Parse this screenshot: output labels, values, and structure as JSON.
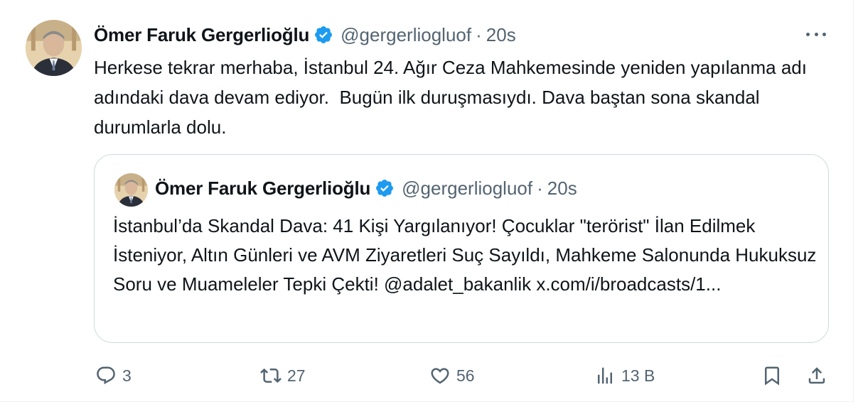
{
  "tweet": {
    "author_name": "Ömer Faruk Gergerlioğlu",
    "handle": "@gergerliogluof",
    "separator": "·",
    "time": "20s",
    "text": "Herkese tekrar merhaba, İstanbul 24. Ağır Ceza Mahkemesinde yeniden yapılanma adı adındaki dava devam ediyor.  Bugün ilk duruşmasıydı. Dava baştan sona skandal durumlarla dolu."
  },
  "quote": {
    "author_name": "Ömer Faruk Gergerlioğlu",
    "handle": "@gergerliogluof",
    "separator": "·",
    "time": "20s",
    "text": "İstanbul’da Skandal Dava: 41 Kişi Yargılanıyor! Çocuklar \"terörist\" İlan Edilmek İsteniyor, Altın Günleri ve AVM Ziyaretleri Suç Sayıldı, Mahkeme Salonunda Hukuksuz Soru ve Muameleler Tepki Çekti! @adalet_bakanlik x.com/i/broadcasts/1..."
  },
  "actions": {
    "replies": "3",
    "reposts": "27",
    "likes": "56",
    "views": "13 B"
  },
  "icons": {
    "verified": "verified-badge-icon",
    "more": "more-icon",
    "reply": "reply-icon",
    "repost": "repost-icon",
    "like": "heart-icon",
    "views": "views-icon",
    "bookmark": "bookmark-icon",
    "share": "share-icon"
  },
  "colors": {
    "text": "#0f1419",
    "secondary": "#536471",
    "verified": "#1d9bf0",
    "border": "#cfd9de"
  }
}
